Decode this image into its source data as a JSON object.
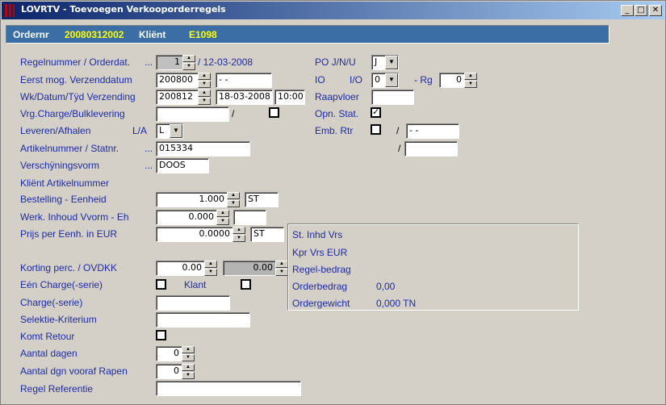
{
  "window": {
    "title": "LOVRTV - Toevoegen Verkooporderregels",
    "minimize": "_",
    "maximize": "□",
    "close": "✕"
  },
  "header": {
    "ordernr_label": "Ordernr",
    "ordernr_value": "20080312002",
    "klient_label": "Kliënt",
    "klient_value": "E1098"
  },
  "labels": {
    "regelnummer": "Regelnummer / Orderdat.",
    "eerst_mog": "Eerst mog. Verzenddatum",
    "wk_datum": "Wk/Datum/Tÿd Verzending",
    "vrg_charge": "Vrg.Charge/Bulklevering",
    "leveren": "Leveren/Afhalen",
    "la": "L/A",
    "artikelnummer": "Artikelnummer / Statnr.",
    "verschijning": "Verschÿningsvorm",
    "klient_artikel": "Kliënt Artikelnummer",
    "bestelling": "Bestelling - Eenheid",
    "werk_inhoud": "Werk. Inhoud Vvorm - Eh",
    "prijs": "Prijs per Eenh. in EUR",
    "korting": "Korting perc. / OVDKK",
    "een_charge": "Eén Charge(-serie)",
    "klant": "Klant",
    "charge_serie": "Charge(-serie)",
    "selektie": "Selektie-Kriterium",
    "komt_retour": "Komt Retour",
    "aantal_dagen": "Aantal dagen",
    "aantal_dgn_vooraf": "Aantal dgn vooraf Rapen",
    "regel_referentie": "Regel Referentie",
    "po_jnu": "PO   J/N/U",
    "io": "IO",
    "io_io": "I/O",
    "rg": "- Rg",
    "raapvloer": "Raapvloer",
    "opn_stat": "Opn. Stat.",
    "emb_rtr": "Emb. Rtr",
    "dots": "...",
    "slash": "/",
    "orderdat": "/ 12-03-2008"
  },
  "values": {
    "regelnummer": "1",
    "eerst_mog": "200800",
    "eerst_mog_date": "- -",
    "wk": "200812",
    "datum": "18-03-2008",
    "tijd": "10:00",
    "vrg_charge": "",
    "leveren": "L",
    "artikelnummer": "015334",
    "verschijning": "DOOS",
    "bestelling": "1.000",
    "bestelling_eh": "ST",
    "werk_inhoud": "0.000",
    "werk_inhoud_eh": "",
    "prijs": "0.0000",
    "prijs_eh": "ST",
    "korting": "0.00",
    "ovdkk": "0.00",
    "charge_serie": "",
    "selektie": "",
    "aantal_dagen": "0",
    "aantal_dgn_vooraf": "0",
    "regel_referentie": "",
    "po_jnu": "J",
    "io": "0",
    "rg": "0",
    "raapvloer": "",
    "opn_stat_check": "✓",
    "emb_rtr_1": "- -",
    "emb_rtr_2": ""
  },
  "summary": {
    "st_inhd_vrs": "St. Inhd Vrs",
    "kpr_vrs": "Kpr Vrs  EUR",
    "regel_bedrag": "Regel-bedrag",
    "orderbedrag_label": "Orderbedrag",
    "orderbedrag_value": "0,00",
    "ordergewicht_label": "Ordergewicht",
    "ordergewicht_value": "0,000 TN"
  },
  "colors": {
    "label_blue": "#1c2ba8",
    "header_band": "#3a6ea5",
    "header_value_yellow": "#ffff00",
    "titlebar_start": "#0a246a"
  }
}
